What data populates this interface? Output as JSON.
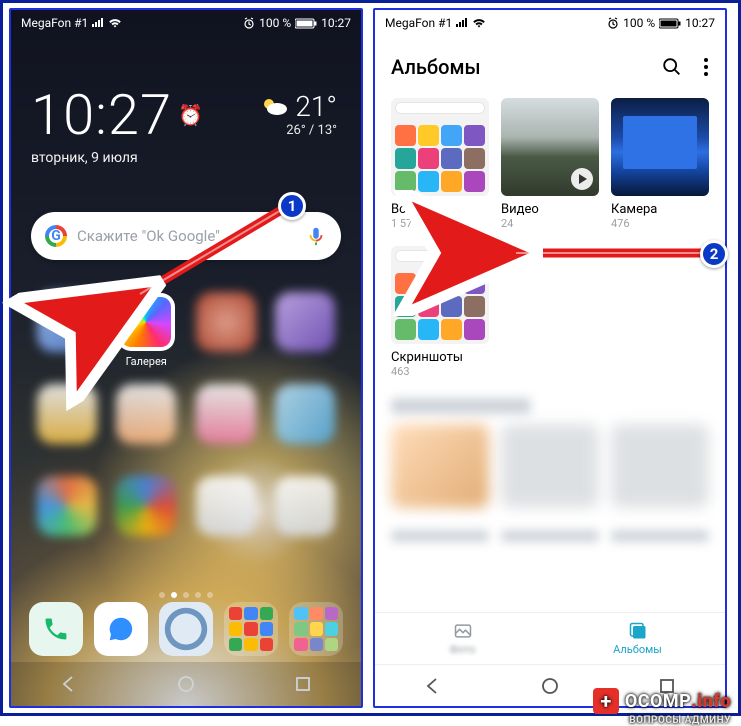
{
  "status": {
    "carrier": "MegaFon #1",
    "battery": "100 %",
    "time": "10:27",
    "alarmIcon": "⏰"
  },
  "home": {
    "clock": "10:27",
    "date": "вторник, 9 июля",
    "weather": {
      "now": "21°",
      "high": "26°",
      "low": "13°"
    },
    "search": {
      "placeholder": "Скажите \"Ok Google\""
    },
    "galleryLabel": "Галерея"
  },
  "gallery": {
    "title": "Альбомы",
    "albums": [
      {
        "name": "Все фото",
        "count": "1 579"
      },
      {
        "name": "Видео",
        "count": "24"
      },
      {
        "name": "Камера",
        "count": "476"
      },
      {
        "name": "Скриншоты",
        "count": "463"
      }
    ],
    "tabs": {
      "photos": "Фото",
      "albums": "Альбомы"
    }
  },
  "annot": {
    "b1": "1",
    "b2": "2"
  },
  "wm": {
    "brand": "OCOMP",
    "tld": ".info",
    "sub": "ВОПРОСЫ АДМИНУ",
    "plus": "+"
  }
}
